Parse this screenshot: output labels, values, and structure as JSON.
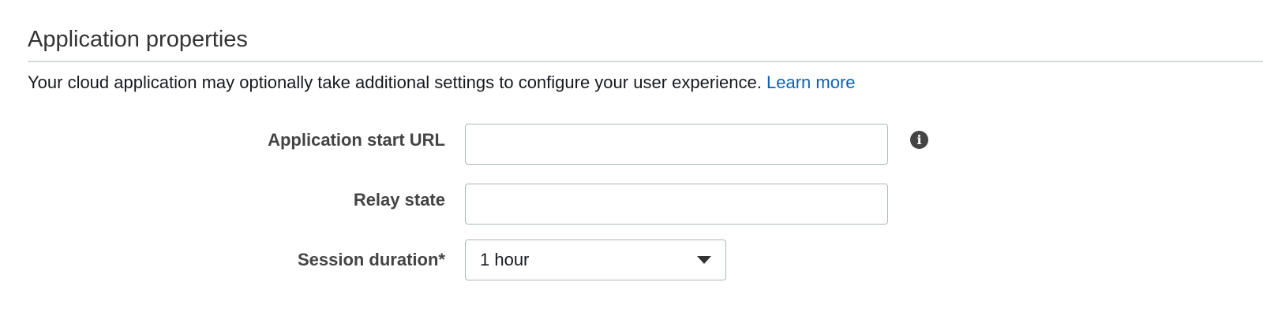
{
  "section": {
    "title": "Application properties",
    "description": "Your cloud application may optionally take additional settings to configure your user experience.",
    "learn_more": "Learn more"
  },
  "fields": {
    "start_url": {
      "label": "Application start URL",
      "value": "",
      "info_icon": "info-icon"
    },
    "relay_state": {
      "label": "Relay state",
      "value": ""
    },
    "session_duration": {
      "label": "Session duration*",
      "selected": "1 hour",
      "caret_icon": "caret-down-icon"
    }
  },
  "colors": {
    "link": "#0a62b8",
    "label": "#444444",
    "border": "#aab7b8"
  }
}
